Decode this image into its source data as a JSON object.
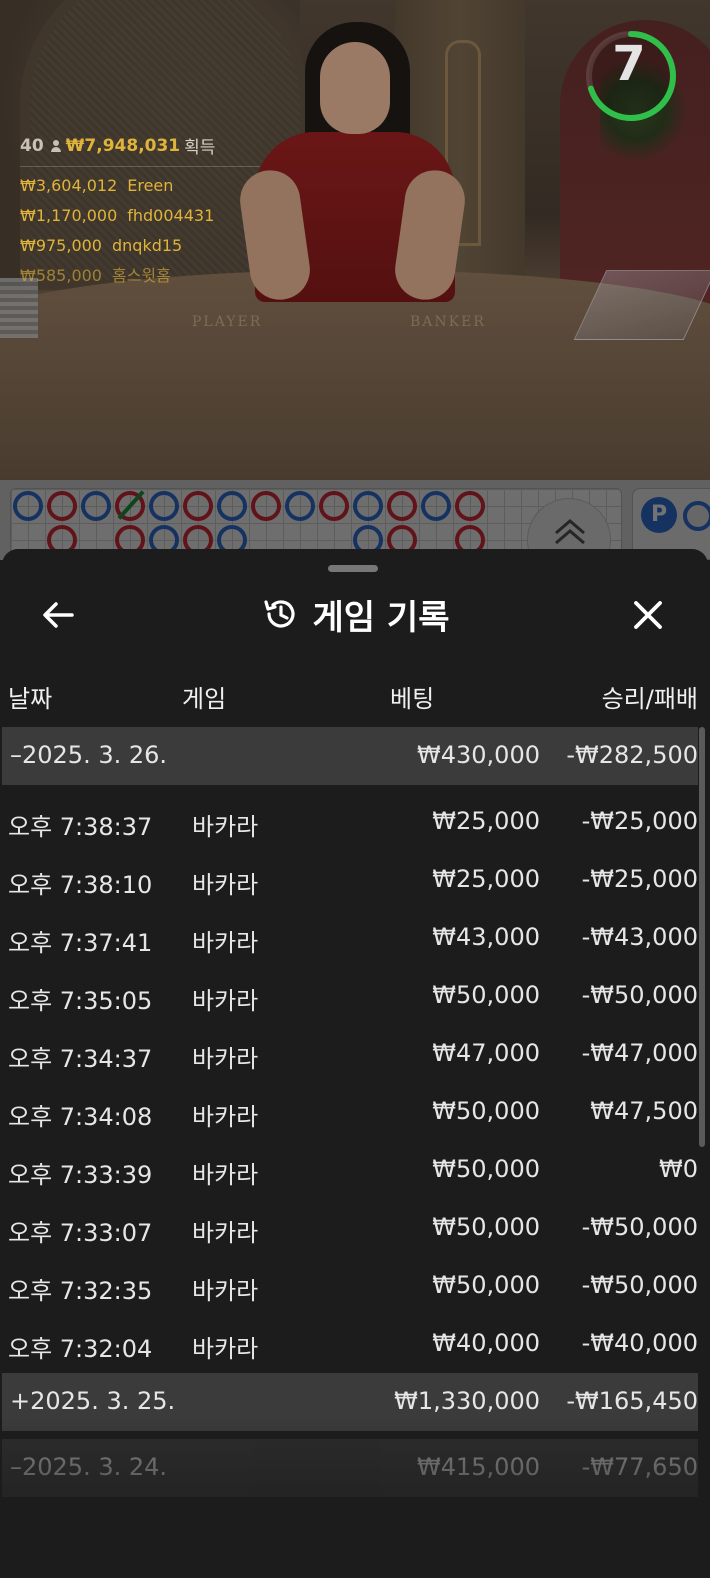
{
  "video": {
    "table_labels": [
      "PLAYER",
      "BANKER"
    ],
    "countdown": "7",
    "countdown_progress": 0.7,
    "winners": {
      "player_count": "40",
      "total": "₩7,948,031",
      "total_label": "획득",
      "list": [
        {
          "amount": "₩3,604,012",
          "name": "Ereen"
        },
        {
          "amount": "₩1,170,000",
          "name": "fhd004431"
        },
        {
          "amount": "₩975,000",
          "name": "dnqkd15"
        },
        {
          "amount": "₩585,000",
          "name": "홈스윗홈"
        }
      ]
    }
  },
  "roadmap": {
    "side_badge": "P",
    "accent_player": "#2f6fd6",
    "accent_banker": "#d42a36"
  },
  "sheet": {
    "title": "게임 기록",
    "icons": {
      "back": "arrow-left-icon",
      "history": "history-icon",
      "close": "close-icon"
    },
    "columns": {
      "date": "날짜",
      "game": "게임",
      "bet": "베팅",
      "result": "승리/패배"
    },
    "day_groups": [
      {
        "toggle": "–",
        "date": "2025. 3. 26.",
        "bet": "₩430,000",
        "result": "-₩282,500",
        "rows": [
          {
            "time": "오후 7:38:37",
            "game": "바카라",
            "bet": "₩25,000",
            "result": "-₩25,000"
          },
          {
            "time": "오후 7:38:10",
            "game": "바카라",
            "bet": "₩25,000",
            "result": "-₩25,000"
          },
          {
            "time": "오후 7:37:41",
            "game": "바카라",
            "bet": "₩43,000",
            "result": "-₩43,000"
          },
          {
            "time": "오후 7:35:05",
            "game": "바카라",
            "bet": "₩50,000",
            "result": "-₩50,000"
          },
          {
            "time": "오후 7:34:37",
            "game": "바카라",
            "bet": "₩47,000",
            "result": "-₩47,000"
          },
          {
            "time": "오후 7:34:08",
            "game": "바카라",
            "bet": "₩50,000",
            "result": "₩47,500"
          },
          {
            "time": "오후 7:33:39",
            "game": "바카라",
            "bet": "₩50,000",
            "result": "₩0"
          },
          {
            "time": "오후 7:33:07",
            "game": "바카라",
            "bet": "₩50,000",
            "result": "-₩50,000"
          },
          {
            "time": "오후 7:32:35",
            "game": "바카라",
            "bet": "₩50,000",
            "result": "-₩50,000"
          },
          {
            "time": "오후 7:32:04",
            "game": "바카라",
            "bet": "₩40,000",
            "result": "-₩40,000"
          }
        ]
      },
      {
        "toggle": "+",
        "date": "2025. 3. 25.",
        "bet": "₩1,330,000",
        "result": "-₩165,450"
      },
      {
        "toggle": "–",
        "date": "2025. 3. 24.",
        "bet": "₩415,000",
        "result": "-₩77,650"
      }
    ]
  }
}
